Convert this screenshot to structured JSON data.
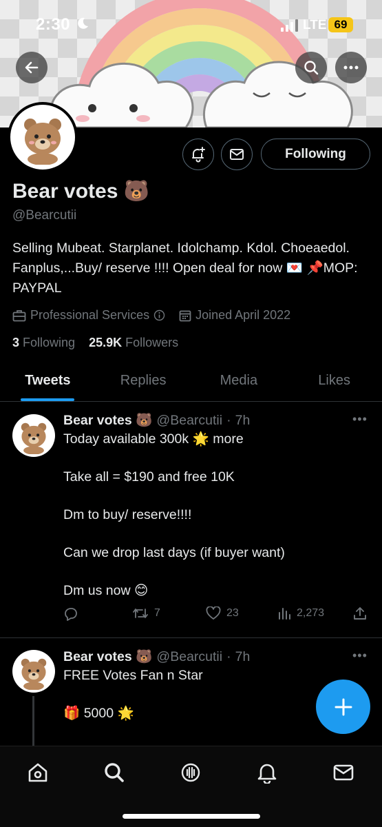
{
  "status_bar": {
    "time": "2:30",
    "network": "LTE",
    "battery": "69"
  },
  "profile": {
    "name": "Bear votes 🐻",
    "handle": "@Bearcutii",
    "bio": "Selling Mubeat. Starplanet. Idolchamp. Kdol. Choeaedol. Fanplus,...Buy/ reserve !!!! Open deal for now 💌 📌MOP: PAYPAL",
    "category": "Professional Services",
    "joined": "Joined April 2022",
    "following_count": "3",
    "following_label": "Following",
    "followers_count": "25.9K",
    "followers_label": "Followers",
    "follow_button": "Following"
  },
  "tabs": [
    {
      "label": "Tweets",
      "active": true
    },
    {
      "label": "Replies",
      "active": false
    },
    {
      "label": "Media",
      "active": false
    },
    {
      "label": "Likes",
      "active": false
    }
  ],
  "tweets": [
    {
      "name": "Bear votes 🐻",
      "handle": "@Bearcutii",
      "time": "7h",
      "lines": [
        "Today available 300k 🌟 more",
        "Take all = $190 and free 10K",
        "Dm to buy/ reserve!!!!",
        "Can we drop last days (if buyer want)",
        "Dm us now 😊"
      ],
      "retweets": "7",
      "likes": "23",
      "views": "2,273"
    },
    {
      "name": "Bear votes 🐻",
      "handle": "@Bearcutii",
      "time": "7h",
      "lines": [
        "FREE Votes Fan n Star",
        "🎁 5000 🌟"
      ]
    }
  ],
  "colors": {
    "accent": "#1d9bf0",
    "background": "#000000",
    "muted": "#71767b",
    "battery": "#f5c518"
  },
  "icons": [
    "back-arrow-icon",
    "search-icon",
    "more-icon",
    "bell-plus-icon",
    "mail-icon",
    "briefcase-icon",
    "calendar-icon",
    "reply-icon",
    "retweet-icon",
    "heart-icon",
    "views-icon",
    "share-icon",
    "compose-plus-icon",
    "home-icon",
    "spaces-icon",
    "notifications-icon",
    "messages-icon"
  ]
}
